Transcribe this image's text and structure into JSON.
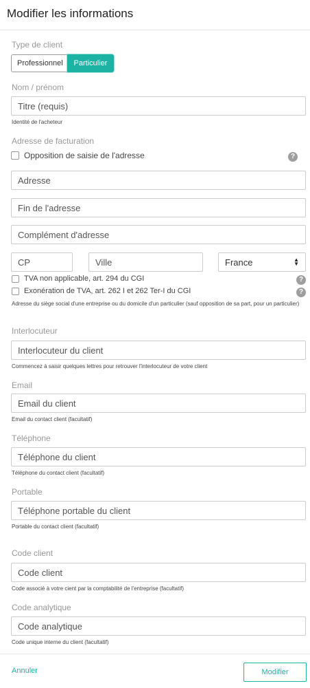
{
  "header": {
    "title": "Modifier les informations"
  },
  "client_type": {
    "label": "Type de client",
    "options": [
      "Professionnel",
      "Particulier"
    ],
    "selected": "Particulier"
  },
  "name": {
    "label": "Nom / prénom",
    "placeholder": "Titre (requis)",
    "value": "",
    "help": "Identité de l'acheteur"
  },
  "billing": {
    "label": "Adresse de facturation",
    "opposition_label": "Opposition de saisie de l'adresse",
    "opposition_checked": false,
    "address_placeholder": "Adresse",
    "address_end_placeholder": "Fin de l'adresse",
    "complement_placeholder": "Complément d'adresse",
    "zip_placeholder": "CP",
    "city_placeholder": "Ville",
    "country": "France",
    "vat_na_label": "TVA non applicable, art. 294 du CGI",
    "vat_na_checked": false,
    "vat_exempt_label": "Exonération de TVA, art. 262 I et 262 Ter-I du CGI",
    "vat_exempt_checked": false,
    "help": "Adresse du siège social d'une entreprise ou du domicile d'un particulier (sauf opposition de sa part, pour un particulier)",
    "help_icon": "?"
  },
  "contact": {
    "label": "Interlocuteur",
    "placeholder": "Interlocuteur du client",
    "help": "Commencez à saisir quelques lettres pour retrouver l'interlocuteur de votre client"
  },
  "email": {
    "label": "Email",
    "placeholder": "Email du client",
    "help": "Email du contact client (facultatif)"
  },
  "phone": {
    "label": "Téléphone",
    "placeholder": "Téléphone du client",
    "help": "Téléphone du contact client (facultatif)"
  },
  "mobile": {
    "label": "Portable",
    "placeholder": "Téléphone portable du client",
    "help": "Portable du contact client (facultatif)"
  },
  "client_code": {
    "label": "Code client",
    "placeholder": "Code client",
    "help": "Code associé à votre cient par la comptabilité de l'entreprise (facultatif)"
  },
  "analytic_code": {
    "label": "Code analytique",
    "placeholder": "Code analytique",
    "help": "Code unique interne du client (facultatif)"
  },
  "footer": {
    "cancel_label": "Annuler",
    "submit_label": "Modifier"
  },
  "colors": {
    "accent": "#1db3a4",
    "border": "#cccccc",
    "muted": "#999999"
  },
  "icons": {
    "help": "question-circle-icon",
    "select": "chevron-up-down-icon"
  }
}
